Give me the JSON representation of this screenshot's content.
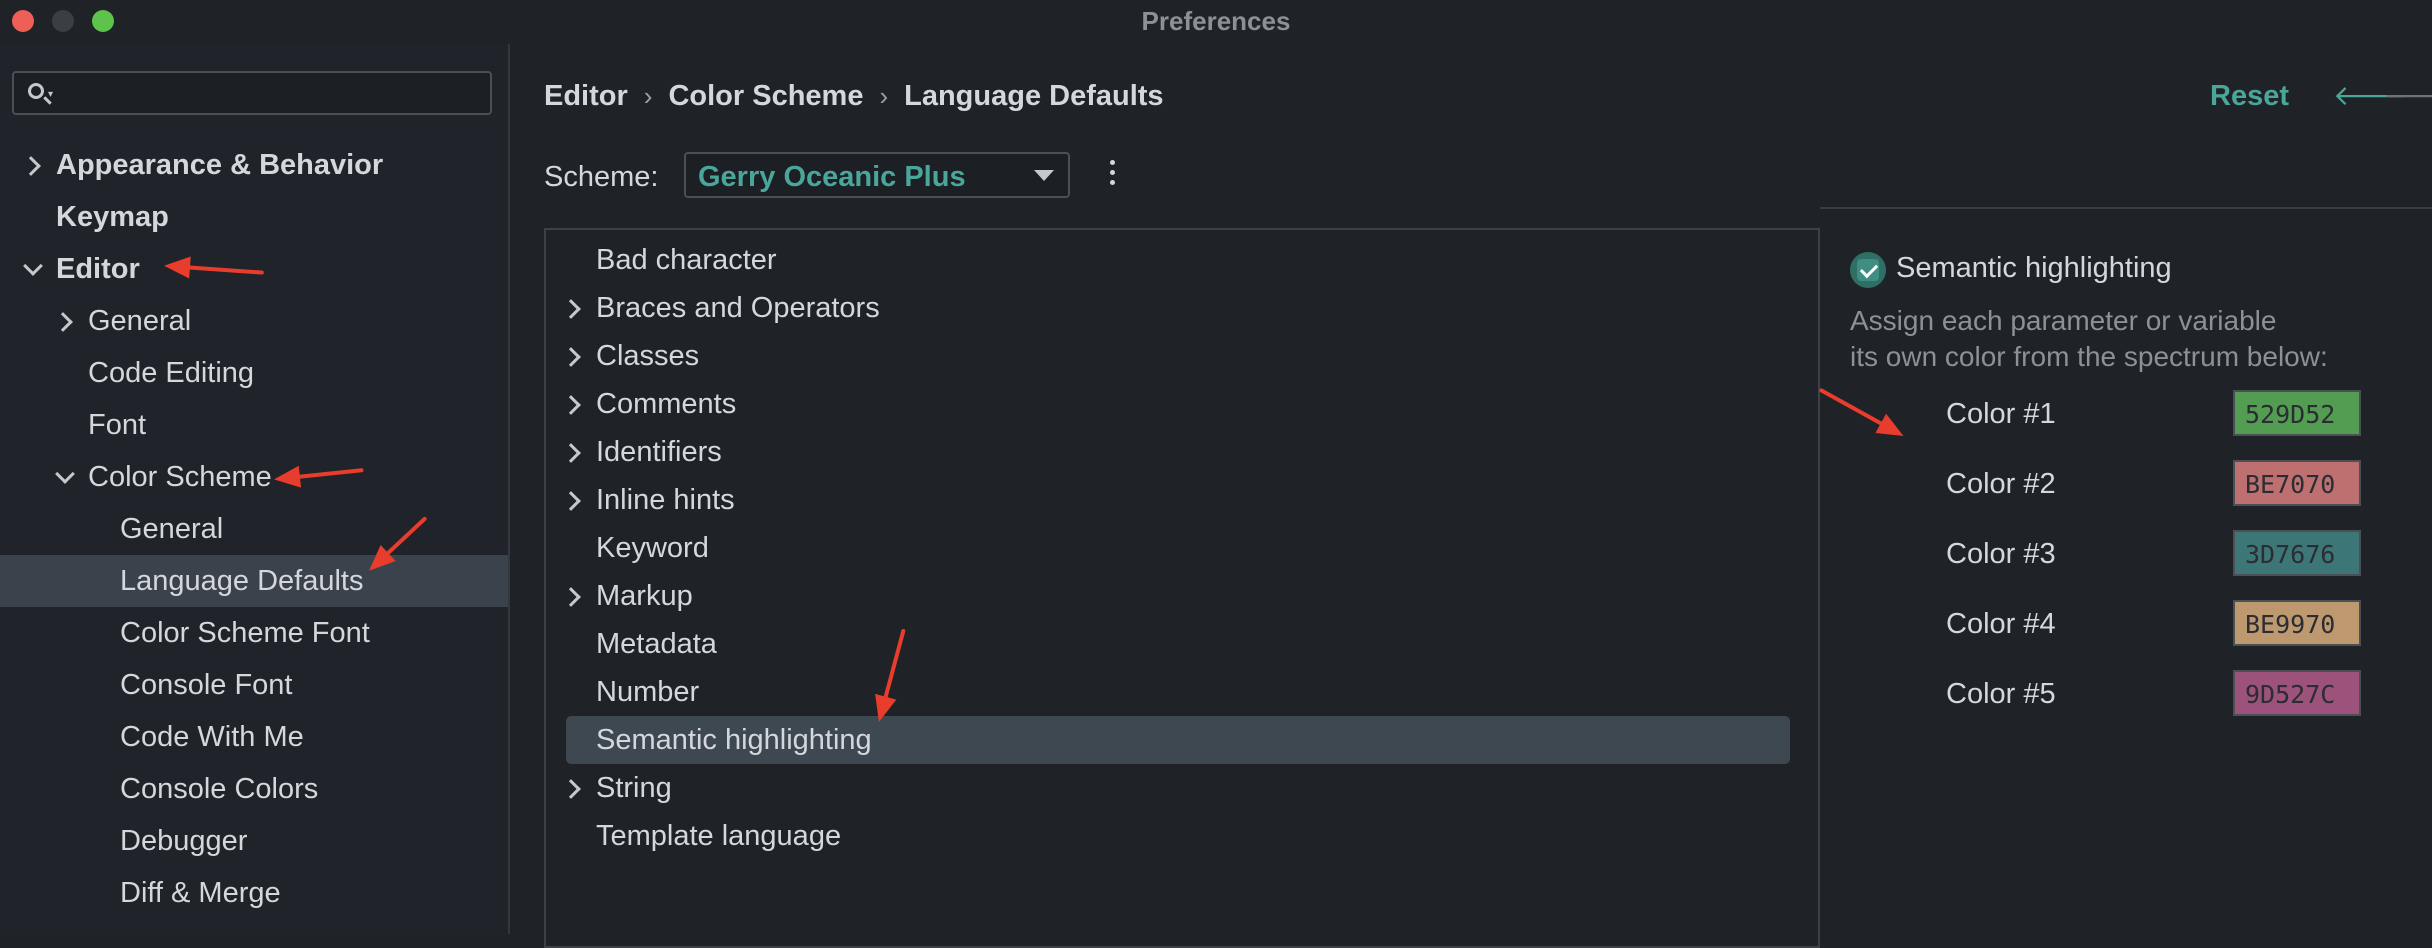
{
  "window": {
    "title": "Preferences"
  },
  "search": {
    "placeholder": ""
  },
  "sidebar": {
    "items": [
      {
        "label": "Appearance & Behavior",
        "bold": true,
        "chevron": "right"
      },
      {
        "label": "Keymap",
        "bold": true,
        "chevron": "none"
      },
      {
        "label": "Editor",
        "bold": true,
        "chevron": "down"
      },
      {
        "label": "General",
        "chevron": "right"
      },
      {
        "label": "Code Editing",
        "chevron": "none"
      },
      {
        "label": "Font",
        "chevron": "none"
      },
      {
        "label": "Color Scheme",
        "chevron": "down"
      },
      {
        "label": "General",
        "chevron": "none"
      },
      {
        "label": "Language Defaults",
        "chevron": "none",
        "selected": true
      },
      {
        "label": "Color Scheme Font",
        "chevron": "none"
      },
      {
        "label": "Console Font",
        "chevron": "none"
      },
      {
        "label": "Code With Me",
        "chevron": "none"
      },
      {
        "label": "Console Colors",
        "chevron": "none"
      },
      {
        "label": "Debugger",
        "chevron": "none"
      },
      {
        "label": "Diff & Merge",
        "chevron": "none"
      }
    ]
  },
  "header": {
    "breadcrumb": [
      "Editor",
      "Color Scheme",
      "Language Defaults"
    ],
    "separator": "›",
    "reset_label": "Reset",
    "back_icon": "arrow-left-icon",
    "forward_icon": "arrow-right-icon"
  },
  "scheme": {
    "label": "Scheme:",
    "value": "Gerry Oceanic Plus"
  },
  "list": {
    "items": [
      {
        "label": "Bad character",
        "expandable": false
      },
      {
        "label": "Braces and Operators",
        "expandable": true
      },
      {
        "label": "Classes",
        "expandable": true
      },
      {
        "label": "Comments",
        "expandable": true
      },
      {
        "label": "Identifiers",
        "expandable": true
      },
      {
        "label": "Inline hints",
        "expandable": true
      },
      {
        "label": "Keyword",
        "expandable": false
      },
      {
        "label": "Markup",
        "expandable": true
      },
      {
        "label": "Metadata",
        "expandable": false
      },
      {
        "label": "Number",
        "expandable": false
      },
      {
        "label": "Semantic highlighting",
        "expandable": false,
        "selected": true
      },
      {
        "label": "String",
        "expandable": true
      },
      {
        "label": "Template language",
        "expandable": false
      }
    ]
  },
  "semantic": {
    "checkbox_label": "Semantic highlighting",
    "checked": true,
    "desc_line1": "Assign each parameter or variable",
    "desc_line2": "its own color from the spectrum below:",
    "colors": [
      {
        "label": "Color #1",
        "hex": "529D52",
        "color": "#529D52"
      },
      {
        "label": "Color #2",
        "hex": "BE7070",
        "color": "#BE7070"
      },
      {
        "label": "Color #3",
        "hex": "3D7676",
        "color": "#3D7676"
      },
      {
        "label": "Color #4",
        "hex": "BE9970",
        "color": "#BE9970"
      },
      {
        "label": "Color #5",
        "hex": "9D527C",
        "color": "#9D527C"
      }
    ]
  },
  "colors": {
    "accent": "#4aa59a",
    "selection": "#3a434c",
    "annotation": "#e83d2c"
  }
}
